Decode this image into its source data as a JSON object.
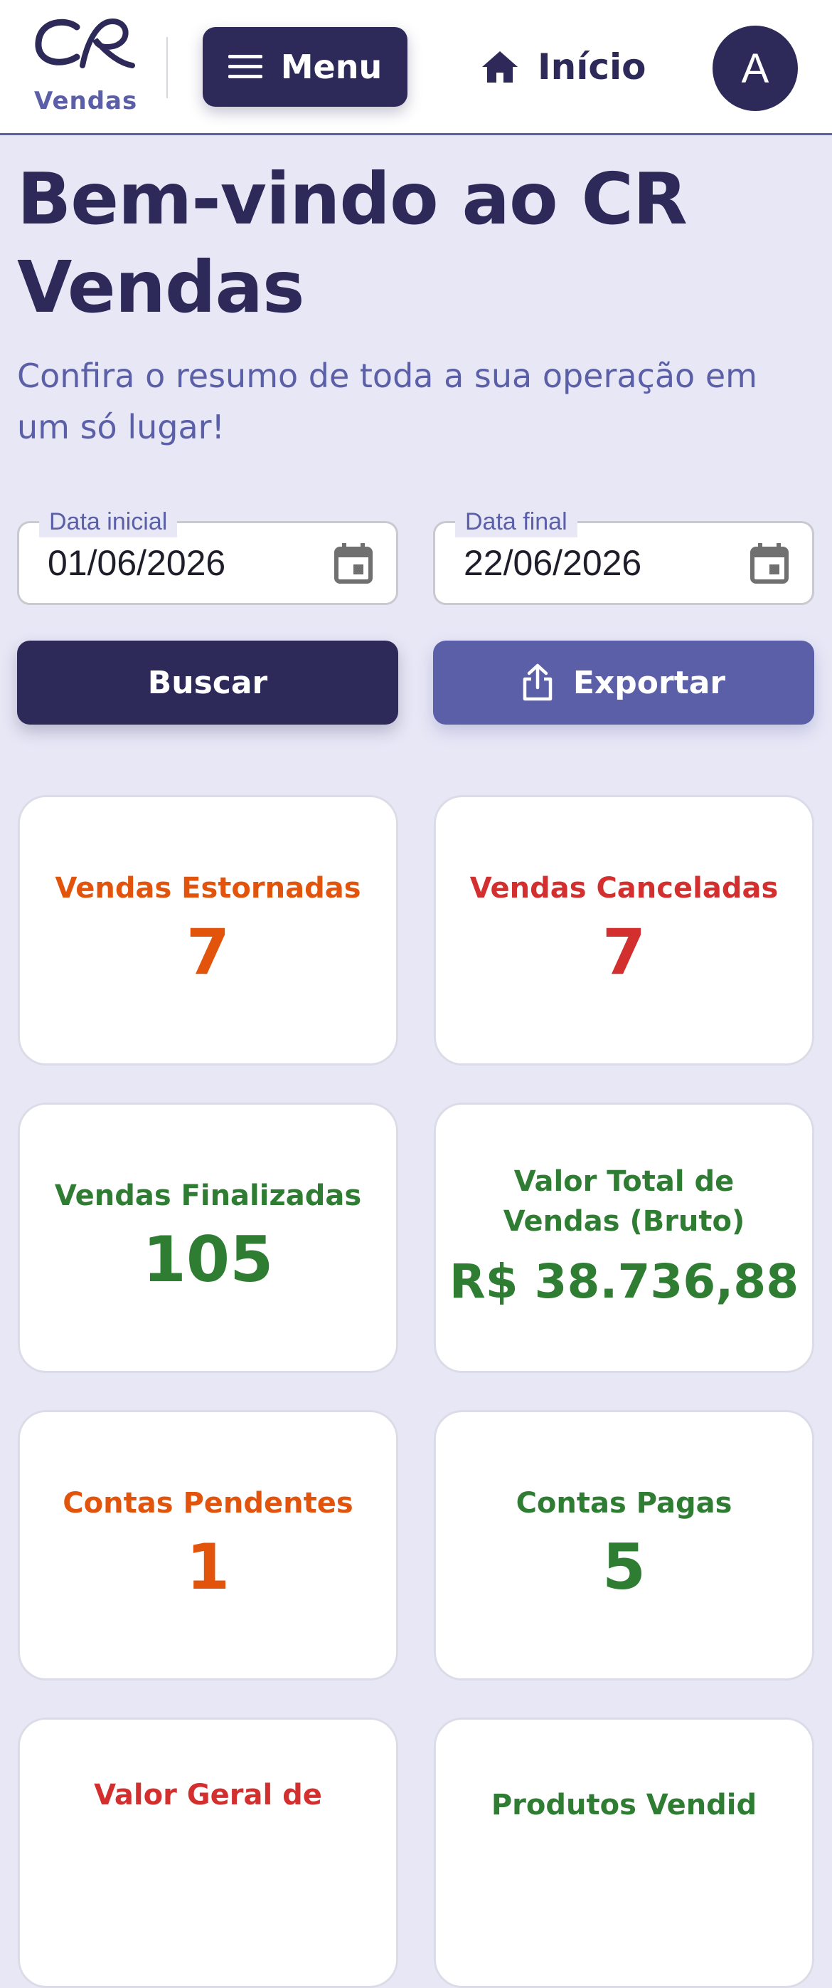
{
  "header": {
    "logo_text": "Vendas",
    "menu_label": "Menu",
    "home_label": "Início",
    "avatar_initial": "A"
  },
  "page": {
    "title": "Bem-vindo ao CR Vendas",
    "subtitle": "Confira o resumo de toda a sua operação em um só lugar!"
  },
  "filters": {
    "start_label": "Data inicial",
    "start_value": "01/06/2026",
    "end_label": "Data final",
    "end_value": "22/06/2026",
    "search_label": "Buscar",
    "export_label": "Exportar"
  },
  "cards": [
    {
      "label": "Vendas Estornadas",
      "value": "7",
      "color": "#e2540c"
    },
    {
      "label": "Vendas Canceladas",
      "value": "7",
      "color": "#d32f2f"
    },
    {
      "label": "Vendas Finalizadas",
      "value": "105",
      "color": "#2e7d32"
    },
    {
      "label": "Valor Total de Vendas (Bruto)",
      "value": "R$ 38.736,88",
      "color": "#2e7d32"
    },
    {
      "label": "Contas Pendentes",
      "value": "1",
      "color": "#e2540c"
    },
    {
      "label": "Contas Pagas",
      "value": "5",
      "color": "#2e7d32"
    },
    {
      "label": "Valor Geral de",
      "color": "#d32f2f"
    },
    {
      "label": "Produtos Vendid",
      "color": "#2e7d32"
    }
  ],
  "colors": {
    "primary": "#2d2a59",
    "accent": "#5a5fa8",
    "background": "#e7e7f6"
  },
  "icons": {
    "menu": "hamburger-icon",
    "home": "home-icon",
    "calendar": "calendar-icon",
    "export": "share-export-icon"
  }
}
